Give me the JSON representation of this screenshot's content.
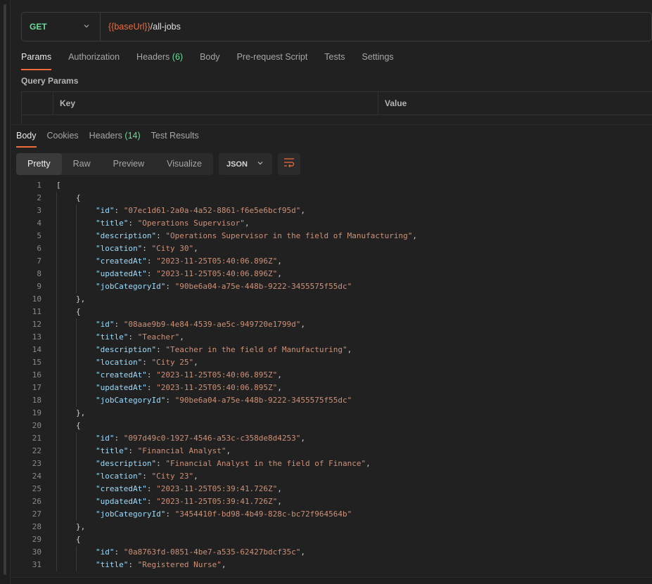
{
  "request": {
    "method": "GET",
    "url_var": "{{baseUrl}}",
    "url_path": "/all-jobs"
  },
  "request_tabs": [
    {
      "label": "Params",
      "count": ""
    },
    {
      "label": "Authorization",
      "count": ""
    },
    {
      "label": "Headers",
      "count": "(6)"
    },
    {
      "label": "Body",
      "count": ""
    },
    {
      "label": "Pre-request Script",
      "count": ""
    },
    {
      "label": "Tests",
      "count": ""
    },
    {
      "label": "Settings",
      "count": ""
    }
  ],
  "query_params": {
    "title": "Query Params",
    "col_key": "Key",
    "col_value": "Value"
  },
  "response_tabs": [
    {
      "label": "Body",
      "count": ""
    },
    {
      "label": "Cookies",
      "count": ""
    },
    {
      "label": "Headers",
      "count": "(14)"
    },
    {
      "label": "Test Results",
      "count": ""
    }
  ],
  "view_modes": [
    "Pretty",
    "Raw",
    "Preview",
    "Visualize"
  ],
  "active_view": "Pretty",
  "format": "JSON",
  "code_lines": [
    {
      "n": "1",
      "indent": 0,
      "t": "["
    },
    {
      "n": "2",
      "indent": 1,
      "t": "{"
    },
    {
      "n": "3",
      "indent": 2,
      "k": "id",
      "v": "07ec1d61-2a0a-4a52-8861-f6e5e6bcf95d",
      "c": ","
    },
    {
      "n": "4",
      "indent": 2,
      "k": "title",
      "v": "Operations Supervisor",
      "c": ","
    },
    {
      "n": "5",
      "indent": 2,
      "k": "description",
      "v": "Operations Supervisor in the field of Manufacturing",
      "c": ","
    },
    {
      "n": "6",
      "indent": 2,
      "k": "location",
      "v": "City 30",
      "c": ","
    },
    {
      "n": "7",
      "indent": 2,
      "k": "createdAt",
      "v": "2023-11-25T05:40:06.896Z",
      "c": ","
    },
    {
      "n": "8",
      "indent": 2,
      "k": "updatedAt",
      "v": "2023-11-25T05:40:06.896Z",
      "c": ","
    },
    {
      "n": "9",
      "indent": 2,
      "k": "jobCategoryId",
      "v": "90be6a04-a75e-448b-9222-3455575f55dc",
      "c": ""
    },
    {
      "n": "10",
      "indent": 1,
      "t": "},"
    },
    {
      "n": "11",
      "indent": 1,
      "t": "{"
    },
    {
      "n": "12",
      "indent": 2,
      "k": "id",
      "v": "08aae9b9-4e84-4539-ae5c-949720e1799d",
      "c": ","
    },
    {
      "n": "13",
      "indent": 2,
      "k": "title",
      "v": "Teacher",
      "c": ","
    },
    {
      "n": "14",
      "indent": 2,
      "k": "description",
      "v": "Teacher in the field of Manufacturing",
      "c": ","
    },
    {
      "n": "15",
      "indent": 2,
      "k": "location",
      "v": "City 25",
      "c": ","
    },
    {
      "n": "16",
      "indent": 2,
      "k": "createdAt",
      "v": "2023-11-25T05:40:06.895Z",
      "c": ","
    },
    {
      "n": "17",
      "indent": 2,
      "k": "updatedAt",
      "v": "2023-11-25T05:40:06.895Z",
      "c": ","
    },
    {
      "n": "18",
      "indent": 2,
      "k": "jobCategoryId",
      "v": "90be6a04-a75e-448b-9222-3455575f55dc",
      "c": ""
    },
    {
      "n": "19",
      "indent": 1,
      "t": "},"
    },
    {
      "n": "20",
      "indent": 1,
      "t": "{"
    },
    {
      "n": "21",
      "indent": 2,
      "k": "id",
      "v": "097d49c0-1927-4546-a53c-c358de8d4253",
      "c": ","
    },
    {
      "n": "22",
      "indent": 2,
      "k": "title",
      "v": "Financial Analyst",
      "c": ","
    },
    {
      "n": "23",
      "indent": 2,
      "k": "description",
      "v": "Financial Analyst in the field of Finance",
      "c": ","
    },
    {
      "n": "24",
      "indent": 2,
      "k": "location",
      "v": "City 23",
      "c": ","
    },
    {
      "n": "25",
      "indent": 2,
      "k": "createdAt",
      "v": "2023-11-25T05:39:41.726Z",
      "c": ","
    },
    {
      "n": "26",
      "indent": 2,
      "k": "updatedAt",
      "v": "2023-11-25T05:39:41.726Z",
      "c": ","
    },
    {
      "n": "27",
      "indent": 2,
      "k": "jobCategoryId",
      "v": "3454410f-bd98-4b49-828c-bc72f964564b",
      "c": ""
    },
    {
      "n": "28",
      "indent": 1,
      "t": "},"
    },
    {
      "n": "29",
      "indent": 1,
      "t": "{"
    },
    {
      "n": "30",
      "indent": 2,
      "k": "id",
      "v": "0a8763fd-0851-4be7-a535-62427bdcf35c",
      "c": ","
    },
    {
      "n": "31",
      "indent": 2,
      "k": "title",
      "v": "Registered Nurse",
      "c": ","
    }
  ]
}
